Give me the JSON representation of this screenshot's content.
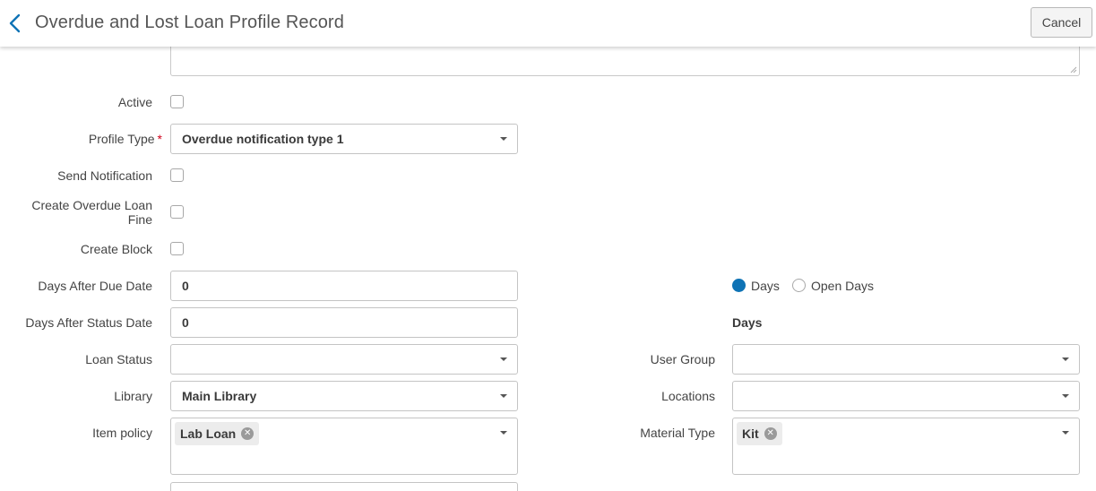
{
  "header": {
    "title": "Overdue and Lost Loan Profile Record",
    "cancel_label": "Cancel"
  },
  "form": {
    "active_label": "Active",
    "profile_type_label": "Profile Type",
    "required_mark": "*",
    "profile_type_value": "Overdue notification type 1",
    "send_notification_label": "Send Notification",
    "create_overdue_fine_label_1": "Create Overdue Loan",
    "create_overdue_fine_label_2": "Fine",
    "create_block_label": "Create Block",
    "days_after_due_label": "Days After Due Date",
    "days_after_due_value": "0",
    "days_after_status_label": "Days After Status Date",
    "days_after_status_value": "0",
    "loan_status_label": "Loan Status",
    "loan_status_value": "",
    "library_label": "Library",
    "library_value": "Main Library",
    "item_policy_label": "Item policy",
    "item_policy_chips": [
      "Lab Loan"
    ],
    "days_radio": {
      "option_1": "Days",
      "option_2": "Open Days",
      "selected": "Days"
    },
    "days_status_unit": "Days",
    "user_group_label": "User Group",
    "user_group_value": "",
    "locations_label": "Locations",
    "locations_value": "",
    "material_type_label": "Material Type",
    "material_type_chips": [
      "Kit"
    ]
  },
  "colors": {
    "accent": "#0f73b5",
    "required": "#d0021b",
    "border": "#c4c4c4"
  }
}
